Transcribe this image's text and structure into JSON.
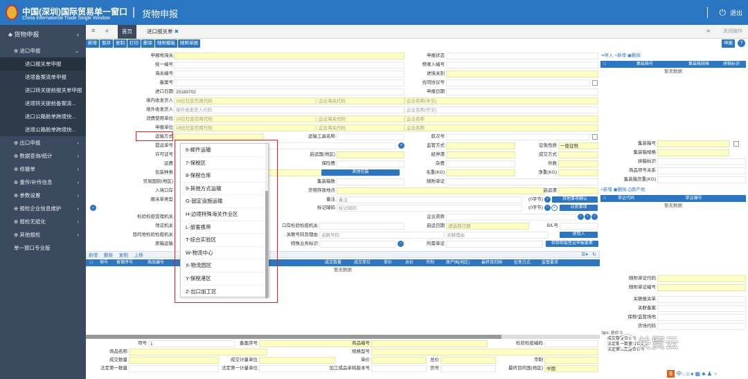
{
  "header": {
    "brand_cn": "中国(深圳)国际贸易单一窗口",
    "brand_en": "China International Trade Single Window",
    "separator": "|",
    "app_title": "货物申报",
    "logout": "退出"
  },
  "sidebar": {
    "section": "货物申报",
    "items": [
      {
        "label": "进口申报",
        "sub": [
          "进口报关单申报",
          "进境备案清单申报",
          "进口转关提前报关单申报",
          "进境转关提前备案清...",
          "进口公路舱单跨境快...",
          "进境公路舱单跨境快..."
        ]
      },
      {
        "label": "出口申报"
      },
      {
        "label": "数据查询/统计"
      },
      {
        "label": "修撤单"
      },
      {
        "label": "重传/补传信息"
      },
      {
        "label": "参数设置"
      },
      {
        "label": "报检企业信息维护"
      },
      {
        "label": "报检无纸化"
      },
      {
        "label": "其他报检"
      },
      {
        "label": "单一窗口专业版"
      }
    ]
  },
  "tabs": {
    "home": "首页",
    "current": "进口报关单",
    "close": "✖",
    "right": "关闭操作"
  },
  "toolbar": {
    "buttons": [
      "新增",
      "暂存",
      "复制",
      "打印",
      "删除",
      "随附模板",
      "随附单据"
    ],
    "declare": "申报",
    "help": "?"
  },
  "form": {
    "labels": {
      "declare_site": "申报地海关",
      "declare_status": "申报状态",
      "unified_no": "统一编号",
      "preentry_no": "预录入编号",
      "customs_no": "海关编号",
      "entry_port": "进境关别",
      "record_no": "备案号",
      "agreement_no": "合同协议号",
      "import_date": "进口日期",
      "declare_date": "申报日期",
      "domestic_consignee": "境内收发货人",
      "foreign_consignor": "境外收发货人",
      "consumer_unit": "消费使用单位",
      "declare_unit": "申报单位",
      "transport_mode": "运输方式",
      "transport_name": "运输工具名称",
      "voyage_no": "航次号",
      "bill_no": "提运单号",
      "supervision_mode": "监管方式",
      "levy_nature": "征免性质",
      "levy_nature_val": "一般征税",
      "license_no": "许可证号",
      "departure_country": "启运国(地区)",
      "via_port": "经停港",
      "deal_mode": "成交方式",
      "freight": "运费",
      "insurance": "保险费",
      "misc_fee": "杂费",
      "pieces": "件数",
      "pack_type": "包装种类",
      "other_pack": "其他包装",
      "gross_weight": "毛重(KG)",
      "net_weight": "净重(KG)",
      "trade_country": "贸易国别(地区)",
      "container_count": "集装箱数",
      "attached_docs": "随附单证",
      "entry_port_place": "入境口岸",
      "goods_location": "货物存放地点",
      "departure_port": "启运港",
      "declare_type": "报关单类型",
      "remark": "备注",
      "remark_val": "备注",
      "other_matters": "其他事项确认",
      "mark_code": "标记唛码",
      "mark_code_val": "标记唛码",
      "chars_count_a": "(0字节)",
      "chars_count_b": "(0字节)",
      "business_matters": "业务事项",
      "inspection_office": "检验检疫受理机关",
      "enterprise_qualification": "企业资质",
      "receiving_office": "领证机关",
      "port_inspection_office": "口岸检验检疫机关",
      "departure_date": "启运日期",
      "departure_date_ph": "请选择日期",
      "bl_no": "B/L号",
      "destination_office": "目的地检验检疫机关",
      "related_no": "关联号码及理由",
      "related_no_val": "关联号码",
      "related_reason": "关联理由",
      "use_person": "使用人",
      "original_port": "原箱运输",
      "special_business": "特殊业务标识",
      "required_docs": "所需单证",
      "inspection_sign": "检验检疫签证申报要素"
    },
    "values": {
      "import_date": "20180702"
    },
    "placeholders": {
      "credit_code": "18位社会信用代码",
      "customs_code": "企业海关代码",
      "name_cn": "企业名称(中文)",
      "name_en": "企业名称(外文)",
      "foreign_code": "境外收发货人代码",
      "name": "企业名称"
    },
    "goods_toolbar": [
      "新增",
      "删除",
      "复制",
      "上移"
    ],
    "goods_toolbar_more": "改",
    "goods_grid": [
      "项号",
      "备案序号",
      "商品编号",
      "规格",
      "成交数量",
      "成交单位",
      "单价",
      "总价",
      "币制",
      "原产国(地区)",
      "最终目的国",
      "征免方式",
      "监管要求"
    ],
    "no_data": "暂无数据",
    "bottom_labels": {
      "item_no": "项号",
      "record_seq": "备案序号",
      "hs_code": "商品编号",
      "inspection_code": "检验检疫编码",
      "goods_name": "商品名称",
      "spec_model": "规格型号",
      "deal_qty": "成交数量",
      "deal_unit": "成交计量单位",
      "unit_price": "单价",
      "total_price": "总价",
      "currency": "币制",
      "legal_qty1": "法定第一数量",
      "legal_unit1": "法定第一计量单位",
      "processed_version": "加工成品单耗版本号",
      "cargo_no": "货号",
      "final_dest": "最终目的国(地区)",
      "final_dest_val": "中国",
      "item_one": "1"
    }
  },
  "right_panel": {
    "toolbar": [
      "导入",
      "新增",
      "删除"
    ],
    "container_grid": [
      "集装箱号",
      "集装箱规格",
      "拼箱标识"
    ],
    "no_data": "暂无数据",
    "container_fields": [
      "集装箱号",
      "集装箱规格",
      "拼箱标识",
      "商品项号关系",
      "集装箱货重(KG)"
    ],
    "docs_toolbar": [
      "新增",
      "删除",
      "原产地"
    ],
    "docs_grid": [
      "单证代码",
      "单证编号"
    ],
    "attached_fields": [
      "随附单证代码",
      "随附单证编号"
    ],
    "related_fields": [
      "关联报关单",
      "关联备案",
      "保税/监管场地",
      "货场代码"
    ],
    "tips": [
      "tips: 总价 0",
      "成交数量合计 0",
      "法定第一数量合计 0",
      "法定第二数量合计 0"
    ]
  },
  "dropdown": {
    "items": [
      "6-邮件运输",
      "7-保税区",
      "8-保税仓库",
      "9-其他方式运输",
      "G-固定设施运输",
      "H-边境特殊海关作业区",
      "L-旅客携带",
      "T-综合实验区",
      "W-物流中心",
      "X-物流园区",
      "Y-保税港区",
      "Z-出口加工区"
    ]
  },
  "watermark": "关贸云",
  "tray": {
    "s": "S",
    "rest": "中·,☺♦ ▦ ♣ ♟ ♀"
  },
  "colors": {
    "primary": "#2b76c2",
    "sidebar": "#3b4a5e",
    "field_yellow": "#ffffc4",
    "highlight": "#e02020"
  }
}
